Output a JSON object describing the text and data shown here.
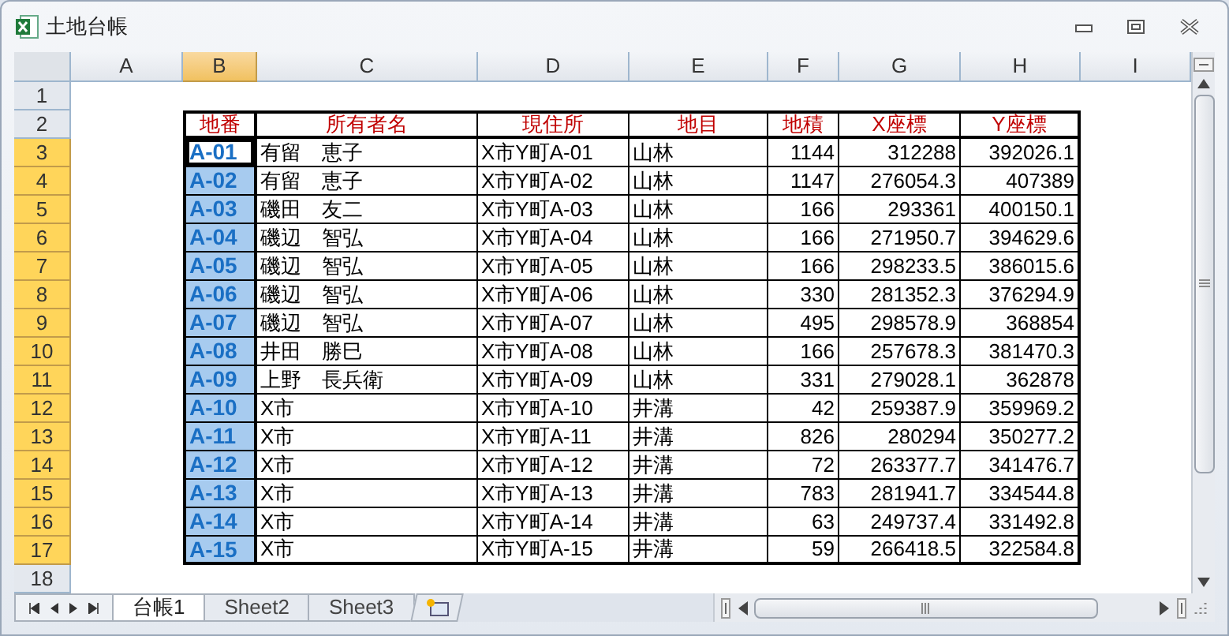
{
  "window": {
    "title": "土地台帳"
  },
  "column_headers": [
    {
      "label": "A",
      "selected": false
    },
    {
      "label": "B",
      "selected": true
    },
    {
      "label": "C",
      "selected": false
    },
    {
      "label": "D",
      "selected": false
    },
    {
      "label": "E",
      "selected": false
    },
    {
      "label": "F",
      "selected": false
    },
    {
      "label": "G",
      "selected": false
    },
    {
      "label": "H",
      "selected": false
    },
    {
      "label": "I",
      "selected": false
    }
  ],
  "row_headers": [
    {
      "label": "1",
      "selected": false
    },
    {
      "label": "2",
      "selected": false
    },
    {
      "label": "3",
      "selected": true
    },
    {
      "label": "4",
      "selected": true
    },
    {
      "label": "5",
      "selected": true
    },
    {
      "label": "6",
      "selected": true
    },
    {
      "label": "7",
      "selected": true
    },
    {
      "label": "8",
      "selected": true
    },
    {
      "label": "9",
      "selected": true
    },
    {
      "label": "10",
      "selected": true
    },
    {
      "label": "11",
      "selected": true
    },
    {
      "label": "12",
      "selected": true
    },
    {
      "label": "13",
      "selected": true
    },
    {
      "label": "14",
      "selected": true
    },
    {
      "label": "15",
      "selected": true
    },
    {
      "label": "16",
      "selected": true
    },
    {
      "label": "17",
      "selected": true
    },
    {
      "label": "18",
      "selected": false
    }
  ],
  "table": {
    "columns": [
      "地番",
      "所有者名",
      "現住所",
      "地目",
      "地積",
      "X座標",
      "Y座標"
    ],
    "rows": [
      {
        "cells": [
          "A-01",
          "有留　恵子",
          "X市Y町A-01",
          "山林",
          "1144",
          "312288",
          "392026.1"
        ],
        "selected": true,
        "active": true
      },
      {
        "cells": [
          "A-02",
          "有留　恵子",
          "X市Y町A-02",
          "山林",
          "1147",
          "276054.3",
          "407389"
        ],
        "selected": true,
        "active": false
      },
      {
        "cells": [
          "A-03",
          "磯田　友二",
          "X市Y町A-03",
          "山林",
          "166",
          "293361",
          "400150.1"
        ],
        "selected": true,
        "active": false
      },
      {
        "cells": [
          "A-04",
          "磯辺　智弘",
          "X市Y町A-04",
          "山林",
          "166",
          "271950.7",
          "394629.6"
        ],
        "selected": true,
        "active": false
      },
      {
        "cells": [
          "A-05",
          "磯辺　智弘",
          "X市Y町A-05",
          "山林",
          "166",
          "298233.5",
          "386015.6"
        ],
        "selected": true,
        "active": false
      },
      {
        "cells": [
          "A-06",
          "磯辺　智弘",
          "X市Y町A-06",
          "山林",
          "330",
          "281352.3",
          "376294.9"
        ],
        "selected": true,
        "active": false
      },
      {
        "cells": [
          "A-07",
          "磯辺　智弘",
          "X市Y町A-07",
          "山林",
          "495",
          "298578.9",
          "368854"
        ],
        "selected": true,
        "active": false
      },
      {
        "cells": [
          "A-08",
          "井田　勝巳",
          "X市Y町A-08",
          "山林",
          "166",
          "257678.3",
          "381470.3"
        ],
        "selected": true,
        "active": false
      },
      {
        "cells": [
          "A-09",
          "上野　長兵衛",
          "X市Y町A-09",
          "山林",
          "331",
          "279028.1",
          "362878"
        ],
        "selected": true,
        "active": false
      },
      {
        "cells": [
          "A-10",
          "X市",
          "X市Y町A-10",
          "井溝",
          "42",
          "259387.9",
          "359969.2"
        ],
        "selected": true,
        "active": false
      },
      {
        "cells": [
          "A-11",
          "X市",
          "X市Y町A-11",
          "井溝",
          "826",
          "280294",
          "350277.2"
        ],
        "selected": true,
        "active": false
      },
      {
        "cells": [
          "A-12",
          "X市",
          "X市Y町A-12",
          "井溝",
          "72",
          "263377.7",
          "341476.7"
        ],
        "selected": true,
        "active": false
      },
      {
        "cells": [
          "A-13",
          "X市",
          "X市Y町A-13",
          "井溝",
          "783",
          "281941.7",
          "334544.8"
        ],
        "selected": true,
        "active": false
      },
      {
        "cells": [
          "A-14",
          "X市",
          "X市Y町A-14",
          "井溝",
          "63",
          "249737.4",
          "331492.8"
        ],
        "selected": true,
        "active": false
      },
      {
        "cells": [
          "A-15",
          "X市",
          "X市Y町A-15",
          "井溝",
          "59",
          "266418.5",
          "322584.8"
        ],
        "selected": true,
        "active": false
      }
    ]
  },
  "sheet_tabs": [
    {
      "label": "台帳1",
      "selected": true
    },
    {
      "label": "Sheet2",
      "selected": false
    },
    {
      "label": "Sheet3",
      "selected": false
    }
  ]
}
